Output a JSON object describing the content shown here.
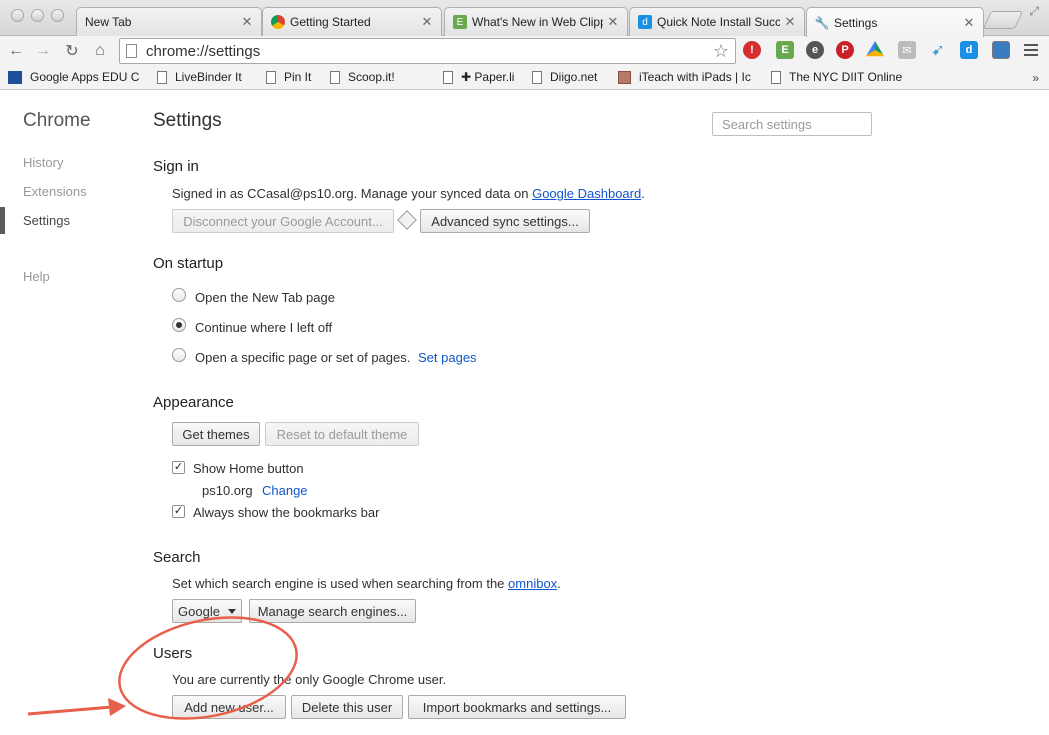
{
  "tabs": [
    {
      "title": "New Tab",
      "favicon": "none"
    },
    {
      "title": "Getting Started",
      "favicon": "chrome-icon"
    },
    {
      "title": "What's New in Web Clipp",
      "favicon": "evernote-icon"
    },
    {
      "title": "Quick Note Install Succe",
      "favicon": "diigo-icon"
    },
    {
      "title": "Settings",
      "favicon": "wrench-icon",
      "active": true
    }
  ],
  "toolbar": {
    "url": "chrome://settings",
    "extensions": [
      "lastpass-icon",
      "evernote-clipper-icon",
      "evernote-icon",
      "pinterest-icon",
      "google-drive-icon",
      "mail-icon",
      "twitter-icon",
      "diigo-icon",
      "picture-icon"
    ]
  },
  "bookmarks": [
    {
      "label": "Google Apps EDU Ce",
      "icon": "cuny-icon"
    },
    {
      "label": "LiveBinder It",
      "icon": "page-icon"
    },
    {
      "label": "Pin It",
      "icon": "page-icon"
    },
    {
      "label": "Scoop.it!",
      "icon": "page-icon"
    },
    {
      "label": "✚ Paper.li",
      "icon": "page-icon"
    },
    {
      "label": "Diigo.net",
      "icon": "page-icon"
    },
    {
      "label": "iTeach with iPads | Ic",
      "icon": "photo-icon"
    },
    {
      "label": "The NYC DIIT Online",
      "icon": "page-icon"
    }
  ],
  "bookmarks_more": "»",
  "sidebar": {
    "brand": "Chrome",
    "items": [
      {
        "label": "History"
      },
      {
        "label": "Extensions"
      },
      {
        "label": "Settings",
        "selected": true
      },
      {
        "label": "Help"
      }
    ]
  },
  "main": {
    "title": "Settings",
    "search_placeholder": "Search settings",
    "sign_in": {
      "title": "Sign in",
      "text": "Signed in as CCasal@ps10.org. Manage your synced data on ",
      "link": "Google Dashboard",
      "text_end": ".",
      "disconnect_button": "Disconnect your Google Account...",
      "advanced_button": "Advanced sync settings..."
    },
    "startup": {
      "title": "On startup",
      "options": [
        {
          "label": "Open the New Tab page",
          "checked": false
        },
        {
          "label": "Continue where I left off",
          "checked": true
        },
        {
          "label": "Open a specific page or set of pages.",
          "checked": false
        }
      ],
      "set_pages_link": "Set pages"
    },
    "appearance": {
      "title": "Appearance",
      "get_themes_button": "Get themes",
      "reset_theme_button": "Reset to default theme",
      "show_home_label": "Show Home button",
      "home_page": "ps10.org",
      "change_link": "Change",
      "bookmarks_bar_label": "Always show the bookmarks bar"
    },
    "search": {
      "title": "Search",
      "text": "Set which search engine is used when searching from the ",
      "link": "omnibox",
      "text_end": ".",
      "engine": "Google",
      "manage_button": "Manage search engines..."
    },
    "users": {
      "title": "Users",
      "text": "You are currently the only Google Chrome user.",
      "add_button": "Add new user...",
      "delete_button": "Delete this user",
      "import_button": "Import bookmarks and settings..."
    }
  },
  "annotation": {
    "color": "#e8604c"
  }
}
